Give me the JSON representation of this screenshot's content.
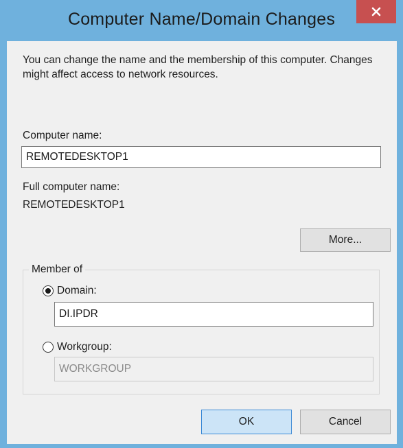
{
  "window": {
    "title": "Computer Name/Domain Changes",
    "close_symbol": "x"
  },
  "dialog": {
    "description": "You can change the name and the membership of this computer. Changes might affect access to network resources.",
    "computer_name_label": "Computer name:",
    "computer_name_value": "REMOTEDESKTOP1",
    "full_name_label": "Full computer name:",
    "full_name_value": "REMOTEDESKTOP1",
    "more_button": "More...",
    "member_of": {
      "legend": "Member of",
      "domain_label": "Domain:",
      "domain_value": "DI.IPDR",
      "domain_selected": true,
      "workgroup_label": "Workgroup:",
      "workgroup_value": "WORKGROUP",
      "workgroup_selected": false
    },
    "ok_button": "OK",
    "cancel_button": "Cancel"
  },
  "colors": {
    "titlebar": "#6fb1dd",
    "close_button": "#c75050",
    "client_bg": "#f0f0f0",
    "default_button_bg": "#cce4f7",
    "default_button_border": "#3c8ad6"
  },
  "icons": {
    "close": "close-icon"
  }
}
